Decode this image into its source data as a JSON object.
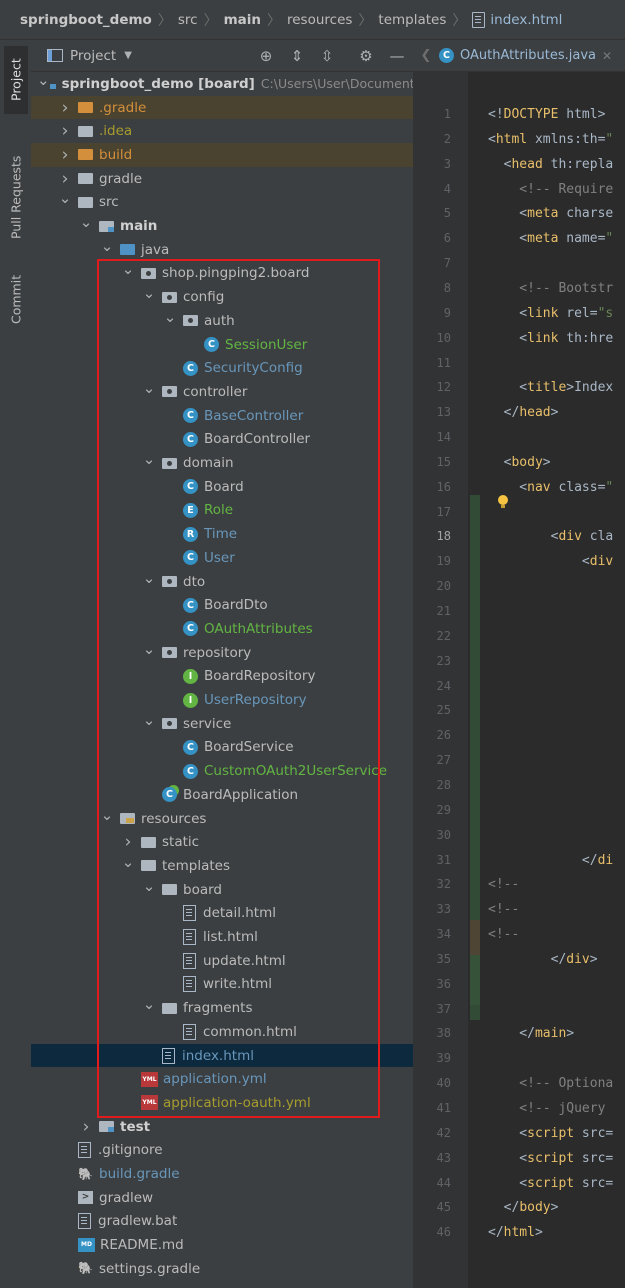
{
  "breadcrumb": {
    "items": [
      "springboot_demo",
      "src",
      "main",
      "resources",
      "templates"
    ],
    "file": "index.html"
  },
  "tool_strip": {
    "tabs": [
      "Project",
      "Pull Requests",
      "Commit"
    ]
  },
  "project_panel": {
    "title": "Project",
    "tree": [
      {
        "label": "springboot_demo [board]",
        "extra": "C:\\Users\\User\\Documents\\",
        "indent": 0,
        "arrow": "down",
        "icon": "module-folder",
        "color": "bold"
      },
      {
        "label": ".gradle",
        "indent": 1,
        "arrow": "right",
        "icon": "folder-orange",
        "color": "orange",
        "hl": true
      },
      {
        "label": ".idea",
        "indent": 1,
        "arrow": "right",
        "icon": "folder-plain",
        "color": "olive"
      },
      {
        "label": "build",
        "indent": 1,
        "arrow": "right",
        "icon": "folder-orange",
        "color": "orange",
        "hl": true
      },
      {
        "label": "gradle",
        "indent": 1,
        "arrow": "right",
        "icon": "folder-plain",
        "color": "white"
      },
      {
        "label": "src",
        "indent": 1,
        "arrow": "down",
        "icon": "folder-plain",
        "color": "white"
      },
      {
        "label": "main",
        "indent": 2,
        "arrow": "down",
        "icon": "module-folder",
        "color": "bold"
      },
      {
        "label": "java",
        "indent": 3,
        "arrow": "down",
        "icon": "folder-blue",
        "color": "white"
      },
      {
        "label": "shop.pingping2.board",
        "indent": 4,
        "arrow": "down",
        "icon": "package",
        "color": "white"
      },
      {
        "label": "config",
        "indent": 5,
        "arrow": "down",
        "icon": "package",
        "color": "white"
      },
      {
        "label": "auth",
        "indent": 6,
        "arrow": "down",
        "icon": "package",
        "color": "white"
      },
      {
        "label": "SessionUser",
        "indent": 7,
        "arrow": "none",
        "icon": "class",
        "color": "green"
      },
      {
        "label": "SecurityConfig",
        "indent": 6,
        "arrow": "none",
        "icon": "class",
        "color": "blue"
      },
      {
        "label": "controller",
        "indent": 5,
        "arrow": "down",
        "icon": "package",
        "color": "white"
      },
      {
        "label": "BaseController",
        "indent": 6,
        "arrow": "none",
        "icon": "class",
        "color": "blue"
      },
      {
        "label": "BoardController",
        "indent": 6,
        "arrow": "none",
        "icon": "class",
        "color": "white"
      },
      {
        "label": "domain",
        "indent": 5,
        "arrow": "down",
        "icon": "package",
        "color": "white"
      },
      {
        "label": "Board",
        "indent": 6,
        "arrow": "none",
        "icon": "class",
        "color": "white"
      },
      {
        "label": "Role",
        "indent": 6,
        "arrow": "none",
        "icon": "enum",
        "color": "green"
      },
      {
        "label": "Time",
        "indent": 6,
        "arrow": "none",
        "icon": "record",
        "color": "blue"
      },
      {
        "label": "User",
        "indent": 6,
        "arrow": "none",
        "icon": "class",
        "color": "blue"
      },
      {
        "label": "dto",
        "indent": 5,
        "arrow": "down",
        "icon": "package",
        "color": "white"
      },
      {
        "label": "BoardDto",
        "indent": 6,
        "arrow": "none",
        "icon": "class",
        "color": "white"
      },
      {
        "label": "OAuthAttributes",
        "indent": 6,
        "arrow": "none",
        "icon": "class",
        "color": "green"
      },
      {
        "label": "repository",
        "indent": 5,
        "arrow": "down",
        "icon": "package",
        "color": "white"
      },
      {
        "label": "BoardRepository",
        "indent": 6,
        "arrow": "none",
        "icon": "interface",
        "color": "white"
      },
      {
        "label": "UserRepository",
        "indent": 6,
        "arrow": "none",
        "icon": "interface",
        "color": "blue"
      },
      {
        "label": "service",
        "indent": 5,
        "arrow": "down",
        "icon": "package",
        "color": "white"
      },
      {
        "label": "BoardService",
        "indent": 6,
        "arrow": "none",
        "icon": "class",
        "color": "white"
      },
      {
        "label": "CustomOAuth2UserService",
        "indent": 6,
        "arrow": "none",
        "icon": "class",
        "color": "green"
      },
      {
        "label": "BoardApplication",
        "indent": 5,
        "arrow": "none",
        "icon": "app",
        "color": "white"
      },
      {
        "label": "resources",
        "indent": 3,
        "arrow": "down",
        "icon": "resources",
        "color": "white"
      },
      {
        "label": "static",
        "indent": 4,
        "arrow": "right",
        "icon": "folder-plain",
        "color": "white"
      },
      {
        "label": "templates",
        "indent": 4,
        "arrow": "down",
        "icon": "folder-plain",
        "color": "white"
      },
      {
        "label": "board",
        "indent": 5,
        "arrow": "down",
        "icon": "folder-plain",
        "color": "white"
      },
      {
        "label": "detail.html",
        "indent": 6,
        "arrow": "none",
        "icon": "file",
        "color": "white"
      },
      {
        "label": "list.html",
        "indent": 6,
        "arrow": "none",
        "icon": "file",
        "color": "white"
      },
      {
        "label": "update.html",
        "indent": 6,
        "arrow": "none",
        "icon": "file",
        "color": "white"
      },
      {
        "label": "write.html",
        "indent": 6,
        "arrow": "none",
        "icon": "file",
        "color": "white"
      },
      {
        "label": "fragments",
        "indent": 5,
        "arrow": "down",
        "icon": "folder-plain",
        "color": "white"
      },
      {
        "label": "common.html",
        "indent": 6,
        "arrow": "none",
        "icon": "file",
        "color": "white"
      },
      {
        "label": "index.html",
        "indent": 5,
        "arrow": "none",
        "icon": "file",
        "color": "blue",
        "selected": true
      },
      {
        "label": "application.yml",
        "indent": 4,
        "arrow": "none",
        "icon": "yml",
        "color": "blue"
      },
      {
        "label": "application-oauth.yml",
        "indent": 4,
        "arrow": "none",
        "icon": "yml",
        "color": "olive"
      },
      {
        "label": "test",
        "indent": 2,
        "arrow": "right",
        "icon": "module-folder",
        "color": "bold"
      },
      {
        "label": ".gitignore",
        "indent": 1,
        "arrow": "none",
        "icon": "file",
        "color": "white"
      },
      {
        "label": "build.gradle",
        "indent": 1,
        "arrow": "none",
        "icon": "gradle",
        "color": "blue"
      },
      {
        "label": "gradlew",
        "indent": 1,
        "arrow": "none",
        "icon": "terminal",
        "color": "white"
      },
      {
        "label": "gradlew.bat",
        "indent": 1,
        "arrow": "none",
        "icon": "file",
        "color": "white"
      },
      {
        "label": "README.md",
        "indent": 1,
        "arrow": "none",
        "icon": "md",
        "color": "white"
      },
      {
        "label": "settings.gradle",
        "indent": 1,
        "arrow": "none",
        "icon": "gradle",
        "color": "white"
      }
    ]
  },
  "editor": {
    "tab_label": "OAuthAttributes.java",
    "current_line": 18,
    "line_numbers": [
      "1",
      "2",
      "3",
      "4",
      "5",
      "6",
      "7",
      "8",
      "9",
      "10",
      "11",
      "12",
      "13",
      "14",
      "15",
      "16",
      "17",
      "18",
      "19",
      "20",
      "21",
      "22",
      "23",
      "24",
      "25",
      "26",
      "27",
      "28",
      "29",
      "30",
      "31",
      "32",
      "33",
      "34",
      "35",
      "36",
      "37",
      "38",
      "39",
      "40",
      "41",
      "42",
      "43",
      "44",
      "45",
      "46"
    ],
    "code": [
      {
        "line": 1,
        "parts": [
          [
            "t",
            "<!"
          ],
          [
            "tag",
            "DOCTYPE"
          ],
          [
            "t",
            " html>"
          ]
        ]
      },
      {
        "line": 2,
        "parts": [
          [
            "t",
            "<"
          ],
          [
            "tag",
            "html"
          ],
          [
            "t",
            " xmlns:th="
          ],
          [
            "str",
            "\""
          ]
        ]
      },
      {
        "line": 3,
        "parts": [
          [
            "t",
            "  <"
          ],
          [
            "tag",
            "head"
          ],
          [
            "t",
            " th:repla"
          ]
        ]
      },
      {
        "line": 4,
        "parts": [
          [
            "cm",
            "    <!-- Require"
          ]
        ]
      },
      {
        "line": 5,
        "parts": [
          [
            "t",
            "    <"
          ],
          [
            "tag",
            "meta"
          ],
          [
            "t",
            " charse"
          ]
        ]
      },
      {
        "line": 6,
        "parts": [
          [
            "t",
            "    <"
          ],
          [
            "tag",
            "meta"
          ],
          [
            "t",
            " name="
          ],
          [
            "str",
            "\""
          ]
        ]
      },
      {
        "line": 8,
        "parts": [
          [
            "cm",
            "    <!-- Bootstr"
          ]
        ]
      },
      {
        "line": 9,
        "parts": [
          [
            "t",
            "    <"
          ],
          [
            "tag",
            "link"
          ],
          [
            "t",
            " rel="
          ],
          [
            "str",
            "\"s"
          ]
        ]
      },
      {
        "line": 10,
        "parts": [
          [
            "t",
            "    <"
          ],
          [
            "tag",
            "link"
          ],
          [
            "t",
            " th:hre"
          ]
        ]
      },
      {
        "line": 12,
        "parts": [
          [
            "t",
            "    <"
          ],
          [
            "tag",
            "title"
          ],
          [
            "t",
            ">Index"
          ]
        ]
      },
      {
        "line": 13,
        "parts": [
          [
            "t",
            "  </"
          ],
          [
            "tag",
            "head"
          ],
          [
            "t",
            ">"
          ]
        ]
      },
      {
        "line": 15,
        "parts": [
          [
            "t",
            "  <"
          ],
          [
            "tag",
            "body"
          ],
          [
            "t",
            ">"
          ]
        ]
      },
      {
        "line": 16,
        "parts": [
          [
            "t",
            "    <"
          ],
          [
            "tag",
            "nav"
          ],
          [
            "t",
            " class="
          ],
          [
            "str",
            "\""
          ]
        ]
      },
      {
        "line": 18,
        "parts": [
          [
            "t",
            "        <"
          ],
          [
            "tag",
            "div"
          ],
          [
            "t",
            " cla"
          ]
        ]
      },
      {
        "line": 19,
        "parts": [
          [
            "t",
            "            <"
          ],
          [
            "tag",
            "div"
          ]
        ]
      },
      {
        "line": 31,
        "parts": [
          [
            "t",
            "            </"
          ],
          [
            "tag",
            "di"
          ]
        ]
      },
      {
        "line": 32,
        "parts": [
          [
            "cm",
            "<!--"
          ]
        ]
      },
      {
        "line": 33,
        "parts": [
          [
            "cm",
            "<!--"
          ]
        ]
      },
      {
        "line": 34,
        "parts": [
          [
            "cm",
            "<!--"
          ]
        ]
      },
      {
        "line": 35,
        "parts": [
          [
            "t",
            "        </"
          ],
          [
            "tag",
            "div"
          ],
          [
            "t",
            ">"
          ]
        ]
      },
      {
        "line": 38,
        "parts": [
          [
            "t",
            "    </"
          ],
          [
            "tag",
            "main"
          ],
          [
            "t",
            ">"
          ]
        ]
      },
      {
        "line": 40,
        "parts": [
          [
            "cm",
            "    <!-- Optiona"
          ]
        ]
      },
      {
        "line": 41,
        "parts": [
          [
            "cm",
            "    <!-- jQuery "
          ]
        ]
      },
      {
        "line": 42,
        "parts": [
          [
            "t",
            "    <"
          ],
          [
            "tag",
            "script"
          ],
          [
            "t",
            " src="
          ]
        ]
      },
      {
        "line": 43,
        "parts": [
          [
            "t",
            "    <"
          ],
          [
            "tag",
            "script"
          ],
          [
            "t",
            " src="
          ]
        ]
      },
      {
        "line": 44,
        "parts": [
          [
            "t",
            "    <"
          ],
          [
            "tag",
            "script"
          ],
          [
            "t",
            " src="
          ]
        ]
      },
      {
        "line": 45,
        "parts": [
          [
            "t",
            "  </"
          ],
          [
            "tag",
            "body"
          ],
          [
            "t",
            ">"
          ]
        ]
      },
      {
        "line": 46,
        "parts": [
          [
            "t",
            "</"
          ],
          [
            "tag",
            "html"
          ],
          [
            "t",
            ">"
          ]
        ]
      }
    ]
  },
  "colors": {
    "highlight_box": "#e01b1b",
    "selection": "#0d293e",
    "tag": "#e8bf6a",
    "comment": "#808080"
  }
}
